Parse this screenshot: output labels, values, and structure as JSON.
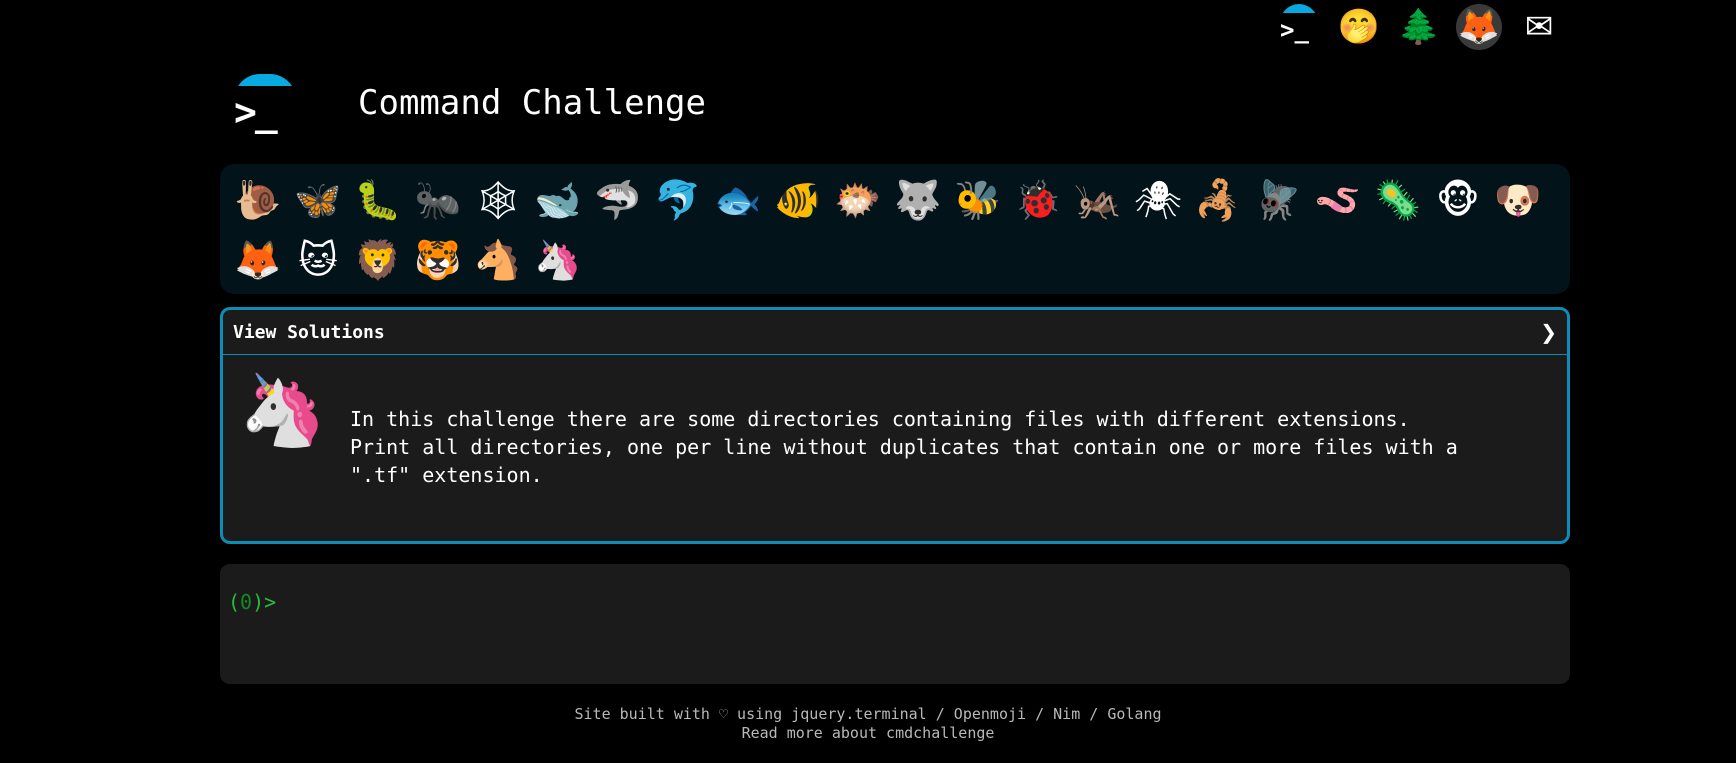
{
  "topbar": {
    "icons": [
      {
        "name": "terminal-logo-icon",
        "glyph": ">_"
      },
      {
        "name": "shushing-face-icon",
        "glyph": "🤭"
      },
      {
        "name": "tree-icon",
        "glyph": "🌲"
      },
      {
        "name": "gitlab-icon",
        "glyph": "🦊"
      },
      {
        "name": "mail-icon",
        "glyph": "✉"
      }
    ]
  },
  "header": {
    "logo_prompt": ">_",
    "title": "Command Challenge"
  },
  "animals": [
    {
      "name": "snail-icon",
      "glyph": "🐌"
    },
    {
      "name": "butterfly-icon",
      "glyph": "🦋"
    },
    {
      "name": "caterpillar-icon",
      "glyph": "🐛"
    },
    {
      "name": "ant-icon",
      "glyph": "🐜"
    },
    {
      "name": "spider-web-icon",
      "glyph": "🕸"
    },
    {
      "name": "whale-icon",
      "glyph": "🐋"
    },
    {
      "name": "shark-icon",
      "glyph": "🦈"
    },
    {
      "name": "dolphin-icon",
      "glyph": "🐬"
    },
    {
      "name": "fish-icon",
      "glyph": "🐟"
    },
    {
      "name": "tropical-fish-icon",
      "glyph": "🐠"
    },
    {
      "name": "pufferfish-icon",
      "glyph": "🐡"
    },
    {
      "name": "wolf-icon",
      "glyph": "🐺"
    },
    {
      "name": "bee-icon",
      "glyph": "🐝"
    },
    {
      "name": "ladybug-icon",
      "glyph": "🐞"
    },
    {
      "name": "cricket-icon",
      "glyph": "🦗"
    },
    {
      "name": "spider-icon",
      "glyph": "🕷"
    },
    {
      "name": "scorpion-icon",
      "glyph": "🦂"
    },
    {
      "name": "fly-icon",
      "glyph": "🪰"
    },
    {
      "name": "worm-icon",
      "glyph": "🪱"
    },
    {
      "name": "microbe-icon",
      "glyph": "🦠"
    },
    {
      "name": "monkey-icon",
      "glyph": "🐵"
    },
    {
      "name": "dog-icon",
      "glyph": "🐶"
    },
    {
      "name": "fox-icon",
      "glyph": "🦊"
    },
    {
      "name": "cat-icon",
      "glyph": "🐱"
    },
    {
      "name": "lion-icon",
      "glyph": "🦁"
    },
    {
      "name": "tiger-icon",
      "glyph": "🐯"
    },
    {
      "name": "horse-icon",
      "glyph": "🐴"
    },
    {
      "name": "unicorn-icon",
      "glyph": "🦄"
    }
  ],
  "panel": {
    "title": "View Solutions",
    "chevron": "❯",
    "image_glyph": "🦄",
    "description": "In this challenge there are some directories containing files with different extensions.\nPrint all directories, one per line without duplicates that contain one or more files with a\n\".tf\" extension."
  },
  "terminal": {
    "prompt_open": "(",
    "prompt_num": "0",
    "prompt_close": ")>"
  },
  "footer": {
    "line1_prefix": "Site built with ♡ using ",
    "link_jquery": "jquery.terminal",
    "sep1": " / ",
    "link_openmoji": "Openmoji",
    "sep2": " / ",
    "link_nim": "Nim",
    "sep3": " / ",
    "link_golang": "Golang",
    "line2": "Read more about cmdchallenge"
  },
  "colors": {
    "accent": "#0c8db8",
    "prompt_green": "#23c03a",
    "background": "#000000"
  }
}
